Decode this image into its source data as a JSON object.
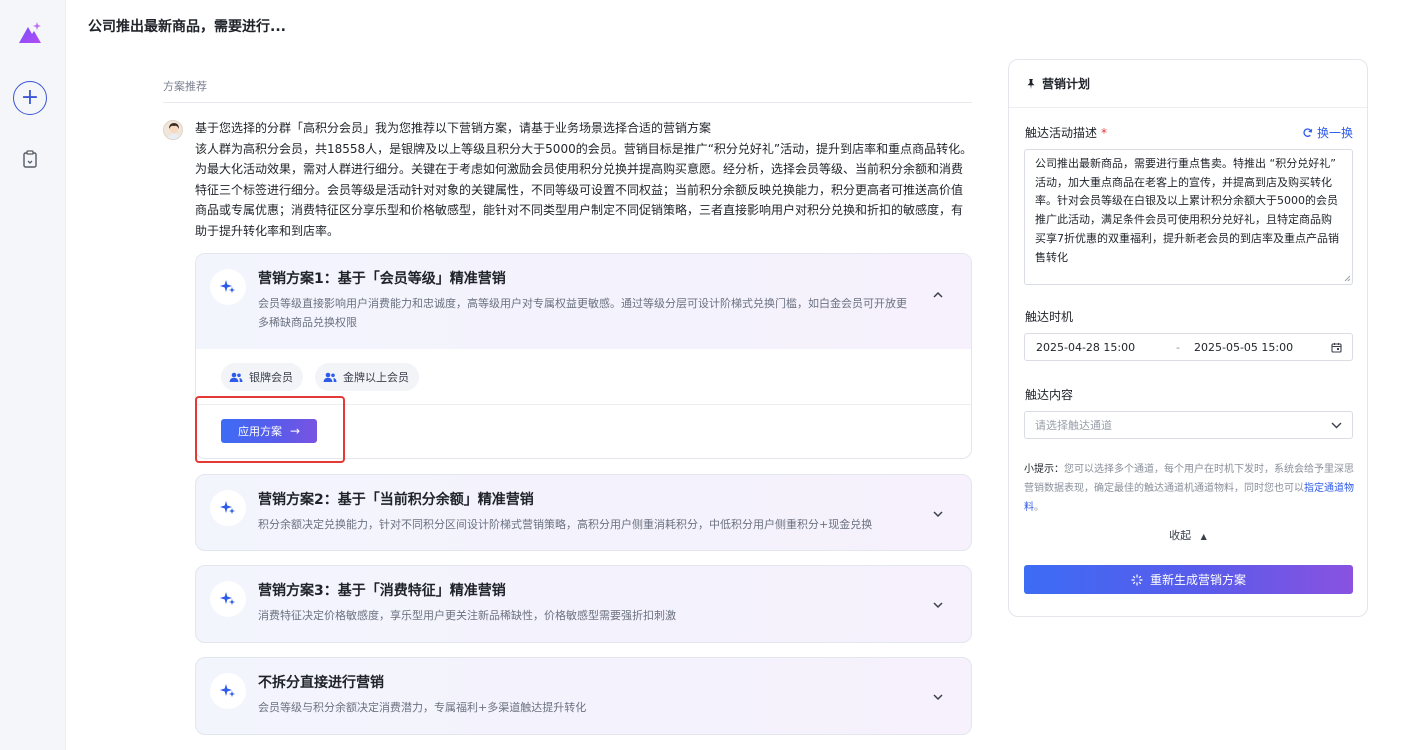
{
  "header": {
    "title": "公司推出最新商品，需要进行..."
  },
  "rail": {
    "logo_icon": "logo-icon",
    "new_icon": "plus-icon",
    "history_icon": "clipboard-icon"
  },
  "main": {
    "section_label": "方案推荐",
    "intro_line1": "基于您选择的分群「高积分会员」我为您推荐以下营销方案，请基于业务场景选择合适的营销方案",
    "intro_body": "该人群为高积分会员，共18558人，是银牌及以上等级且积分大于5000的会员。营销目标是推广“积分兑好礼”活动，提升到店率和重点商品转化。为最大化活动效果，需对人群进行细分。关键在于考虑如何激励会员使用积分兑换并提高购买意愿。经分析，选择会员等级、当前积分余额和消费特征三个标签进行细分。会员等级是活动针对对象的关键属性，不同等级可设置不同权益；当前积分余额反映兑换能力，积分更高者可推送高价值商品或专属优惠；消费特征区分享乐型和价格敏感型，能针对不同类型用户制定不同促销策略，三者直接影响用户对积分兑换和折扣的敏感度，有助于提升转化率和到店率。",
    "plans": [
      {
        "title": "营销方案1：基于「会员等级」精准营销",
        "desc": "会员等级直接影响用户消费能力和忠诚度，高等级用户对专属权益更敏感。通过等级分层可设计阶梯式兑换门槛，如白金会员可开放更多稀缺商品兑换权限",
        "tags": [
          "银牌会员",
          "金牌以上会员"
        ],
        "apply_label": "应用方案"
      },
      {
        "title": "营销方案2：基于「当前积分余额」精准营销",
        "desc": "积分余额决定兑换能力，针对不同积分区间设计阶梯式营销策略，高积分用户侧重消耗积分，中低积分用户侧重积分+现金兑换"
      },
      {
        "title": "营销方案3：基于「消费特征」精准营销",
        "desc": "消费特征决定价格敏感度，享乐型用户更关注新品稀缺性，价格敏感型需要强折扣刺激"
      },
      {
        "title": "不拆分直接进行营销",
        "desc": "会员等级与积分余额决定消费潜力，专属福利+多渠道触达提升转化"
      }
    ]
  },
  "panel": {
    "title": "营销计划",
    "desc_label": "触达活动描述",
    "required_mark": "*",
    "swap_label": "换一换",
    "desc_value": "公司推出最新商品，需要进行重点售卖。特推出 “积分兑好礼” 活动，加大重点商品在老客上的宣传，并提高到店及购买转化率。针对会员等级在白银及以上累计积分余额大于5000的会员推广此活动，满足条件会员可使用积分兑好礼，且特定商品购买享7折优惠的双重福利，提升新老会员的到店率及重点产品销售转化",
    "time_label": "触达时机",
    "start_date": "2025-04-28 15:00",
    "date_sep": "-",
    "end_date": "2025-05-05 15:00",
    "content_label": "触达内容",
    "channel_placeholder": "请选择触达通道",
    "tip_prefix": "小提示：",
    "tip_text": "您可以选择多个通道，每个用户在时机下发时，系统会给予里深思营销数据表现，确定最佳的触达通道机通道物料，同时您也可以",
    "tip_link": "指定通道物料",
    "tip_end": "。",
    "collapse_label": "收起",
    "regen_label": "重新生成营销方案"
  },
  "colors": {
    "accent": "#2f5bea",
    "highlight": "#e53935",
    "gradient_start": "#3d6cf5",
    "gradient_end": "#8a52e0"
  }
}
